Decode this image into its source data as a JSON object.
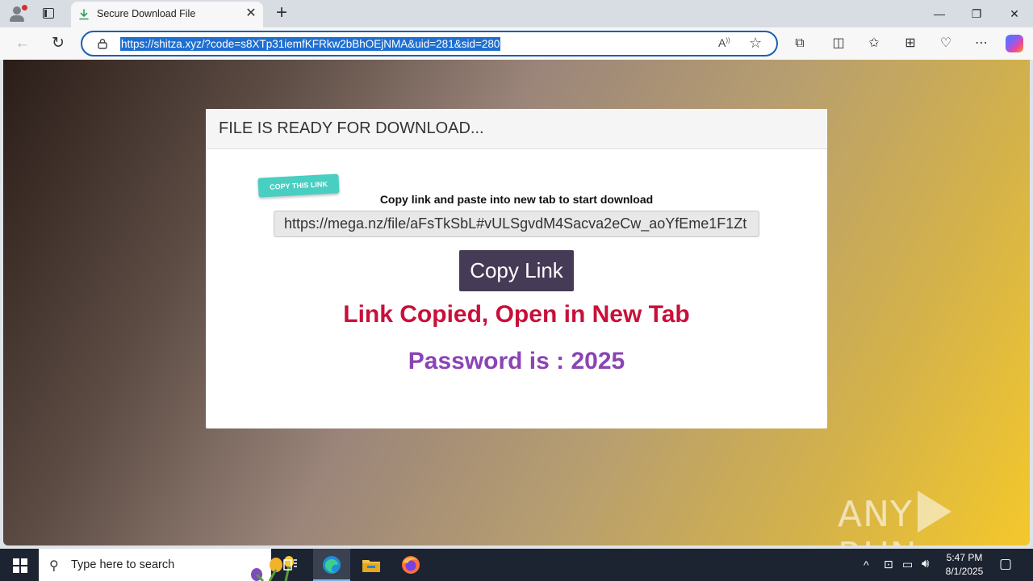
{
  "browser": {
    "tab_title": "Secure Download File",
    "url": "https://shitza.xyz/?code=s8XTp31iemfKFRkw2bBhOEjNMA&uid=281&sid=280"
  },
  "page": {
    "card_header": "FILE IS READY FOR DOWNLOAD...",
    "badge": "COPY THIS LINK",
    "instruction": "Copy link and paste into new tab to start download",
    "link_value": "https://mega.nz/file/aFsTkSbL#vULSgvdM4Sacva2eCw_aoYfEme1F1Zt",
    "copy_button": "Copy Link",
    "copied_message": "Link Copied, Open in New Tab",
    "password_message": "Password is : 2025",
    "watermark_left": "ANY",
    "watermark_right": "RUN"
  },
  "taskbar": {
    "search_placeholder": "Type here to search",
    "time": "5:47 PM",
    "date": "8/1/2025"
  },
  "colors": {
    "accent": "#1f6fd0",
    "copied": "#c8103a",
    "password": "#8a44b5",
    "button": "#463b56",
    "badge": "#48cfc1"
  },
  "icons": [
    "profile-icon",
    "tab-actions-icon",
    "download-icon",
    "close-icon",
    "new-tab-icon",
    "minimize-icon",
    "maximize-icon",
    "window-close-icon",
    "back-icon",
    "refresh-icon",
    "lock-icon",
    "read-aloud-icon",
    "favorite-icon",
    "extensions-icon",
    "split-screen-icon",
    "favorites-icon",
    "collections-icon",
    "browser-essentials-icon",
    "more-icon",
    "copilot-icon",
    "windows-start-icon",
    "search-icon",
    "task-view-icon",
    "edge-icon",
    "file-explorer-icon",
    "firefox-icon",
    "chevron-up-icon",
    "network-icon",
    "volume-icon",
    "notifications-icon"
  ]
}
